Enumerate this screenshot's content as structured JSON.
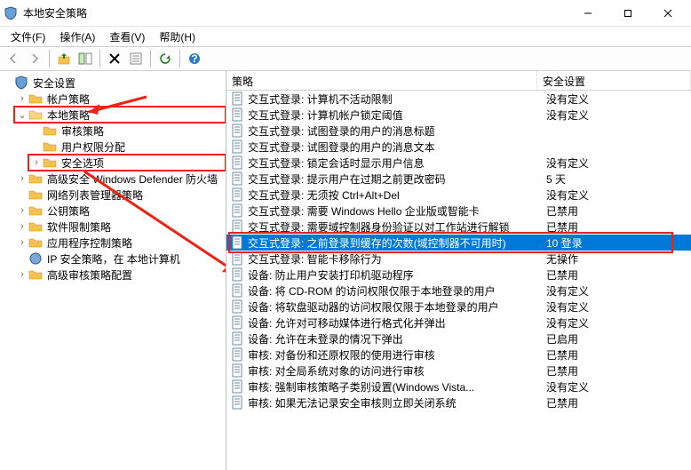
{
  "window": {
    "title": "本地安全策略"
  },
  "menu": {
    "file": "文件(F)",
    "action": "操作(A)",
    "view": "查看(V)",
    "help": "帮助(H)"
  },
  "tree": {
    "root": "安全设置",
    "account": "帐户策略",
    "local": "本地策略",
    "audit": "审核策略",
    "userrights": "用户权限分配",
    "secopts": "安全选项",
    "defender": "高级安全 Windows Defender 防火墙",
    "netlist": "网络列表管理器策略",
    "pubkey": "公钥策略",
    "softrest": "软件限制策略",
    "appctrl": "应用程序控制策略",
    "ipsec": "IP 安全策略，在 本地计算机",
    "advaudit": "高级审核策略配置"
  },
  "cols": {
    "policy": "策略",
    "setting": "安全设置"
  },
  "rows": [
    {
      "p": "交互式登录: 计算机不活动限制",
      "s": "没有定义"
    },
    {
      "p": "交互式登录: 计算机帐户锁定阈值",
      "s": "没有定义"
    },
    {
      "p": "交互式登录: 试图登录的用户的消息标题",
      "s": ""
    },
    {
      "p": "交互式登录: 试图登录的用户的消息文本",
      "s": ""
    },
    {
      "p": "交互式登录: 锁定会话时显示用户信息",
      "s": "没有定义"
    },
    {
      "p": "交互式登录: 提示用户在过期之前更改密码",
      "s": "5 天"
    },
    {
      "p": "交互式登录: 无须按 Ctrl+Alt+Del",
      "s": "没有定义"
    },
    {
      "p": "交互式登录: 需要 Windows Hello 企业版或智能卡",
      "s": "已禁用"
    },
    {
      "p": "交互式登录: 需要域控制器身份验证以对工作站进行解锁",
      "s": "已禁用"
    },
    {
      "p": "交互式登录: 之前登录到缓存的次数(域控制器不可用时)",
      "s": "10 登录",
      "sel": true
    },
    {
      "p": "交互式登录: 智能卡移除行为",
      "s": "无操作"
    },
    {
      "p": "设备: 防止用户安装打印机驱动程序",
      "s": "已禁用"
    },
    {
      "p": "设备: 将 CD-ROM 的访问权限仅限于本地登录的用户",
      "s": "没有定义"
    },
    {
      "p": "设备: 将软盘驱动器的访问权限仅限于本地登录的用户",
      "s": "没有定义"
    },
    {
      "p": "设备: 允许对可移动媒体进行格式化并弹出",
      "s": "没有定义"
    },
    {
      "p": "设备: 允许在未登录的情况下弹出",
      "s": "已启用"
    },
    {
      "p": "审核: 对备份和还原权限的使用进行审核",
      "s": "已禁用"
    },
    {
      "p": "审核: 对全局系统对象的访问进行审核",
      "s": "已禁用"
    },
    {
      "p": "审核: 强制审核策略子类别设置(Windows Vista...",
      "s": "没有定义"
    },
    {
      "p": "审核: 如果无法记录安全审核则立即关闭系统",
      "s": "已禁用"
    }
  ]
}
